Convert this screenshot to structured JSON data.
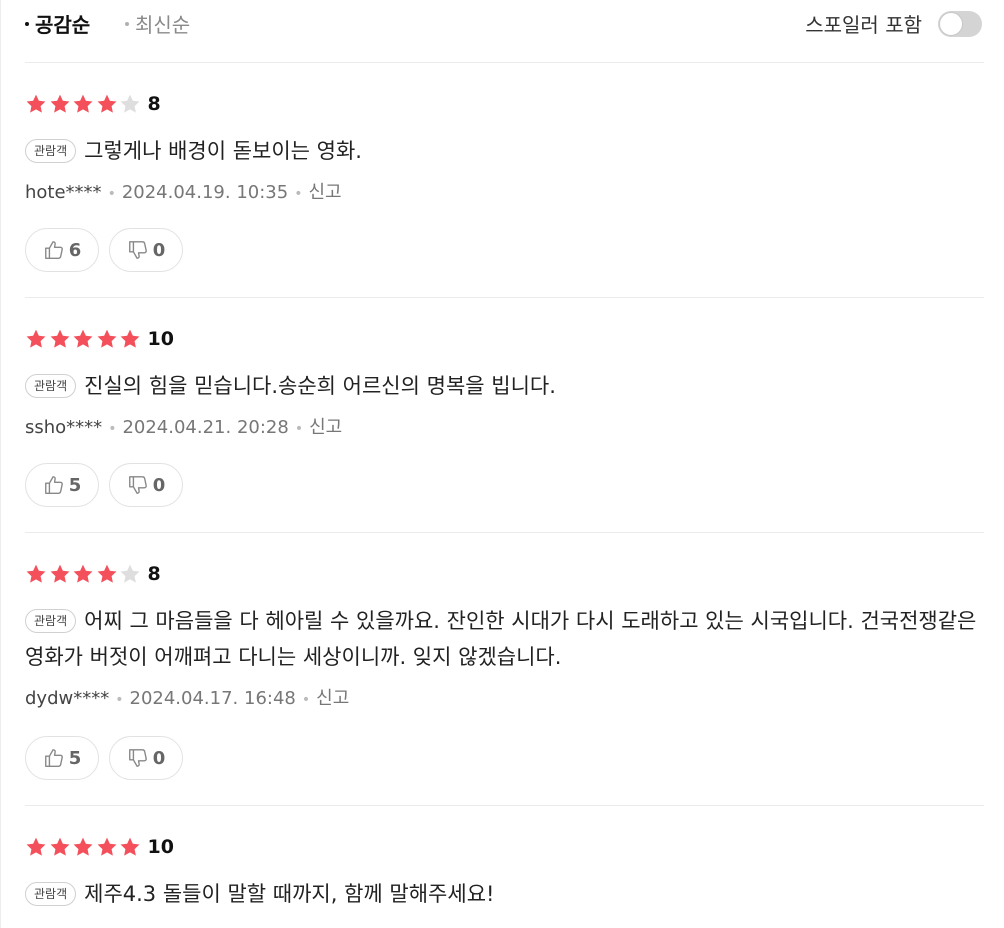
{
  "sort": {
    "active_label": "공감순",
    "inactive_label": "최신순",
    "spoiler_label": "스포일러 포함",
    "spoiler_on": false
  },
  "colors": {
    "star_filled": "#f3505b",
    "star_empty": "#dedede"
  },
  "badge_label": "관람객",
  "report_label": "신고",
  "reviews": [
    {
      "stars": 4,
      "score": "8",
      "text": "그렇게나 배경이 돋보이는 영화.",
      "user": "hote****",
      "date": "2024.04.19. 10:35",
      "likes": "6",
      "dislikes": "0"
    },
    {
      "stars": 5,
      "score": "10",
      "text": "진실의 힘을 믿습니다.송순희 어르신의 명복을 빕니다.",
      "user": "ssho****",
      "date": "2024.04.21. 20:28",
      "likes": "5",
      "dislikes": "0"
    },
    {
      "stars": 4,
      "score": "8",
      "text": "어찌 그 마음들을 다 헤아릴 수 있을까요. 잔인한 시대가 다시 도래하고 있는 시국입니다. 건국전쟁같은 영화가 버젓이 어깨펴고 다니는 세상이니까. 잊지 않겠습니다.",
      "user": "dydw****",
      "date": "2024.04.17. 16:48",
      "likes": "5",
      "dislikes": "0"
    },
    {
      "stars": 5,
      "score": "10",
      "text": "제주4.3 돌들이 말할 때까지, 함께 말해주세요!",
      "user": "",
      "date": "",
      "likes": "",
      "dislikes": ""
    }
  ]
}
